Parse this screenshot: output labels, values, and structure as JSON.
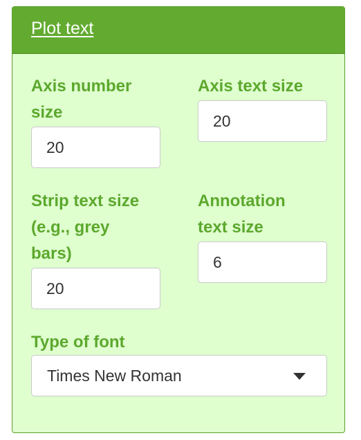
{
  "panel": {
    "title": "Plot text"
  },
  "fields": {
    "axis_number_size": {
      "label_line1": "Axis number",
      "label_line2": "size",
      "value": "20"
    },
    "axis_text_size": {
      "label": "Axis text size",
      "value": "20"
    },
    "strip_text_size": {
      "label_line1": "Strip text size",
      "label_line2": "(e.g., grey",
      "label_line3": "bars)",
      "value": "20"
    },
    "annotation_text_size": {
      "label_line1": "Annotation",
      "label_line2": "text size",
      "value": "6"
    },
    "font_type": {
      "label": "Type of font",
      "selected": "Times New Roman"
    }
  },
  "colors": {
    "header_bg": "#62ab30",
    "panel_bg": "#dfffcf",
    "label_text": "#5ca82d"
  }
}
